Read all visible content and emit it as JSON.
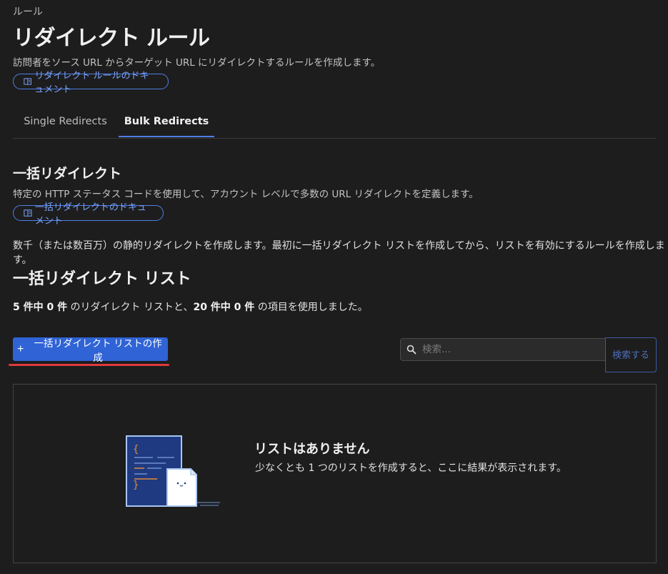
{
  "breadcrumb": "ルール",
  "page": {
    "title": "リダイレクト ルール",
    "subtitle": "訪問者をソース URL からターゲット URL にリダイレクトするルールを作成します。",
    "doc_link": "リダイレクト ルールのドキュメント"
  },
  "tabs": [
    {
      "label": "Single Redirects",
      "active": false
    },
    {
      "label": "Bulk Redirects",
      "active": true
    }
  ],
  "bulk": {
    "title": "一括リダイレクト",
    "description": "特定の HTTP ステータス コードを使用して、アカウント レベルで多数の URL リダイレクトを定義します。",
    "doc_link": "一括リダイレクトのドキュメント",
    "paragraph": "数千（または数百万）の静的リダイレクトを作成します。最初に一括リダイレクト リストを作成してから、リストを有効にするルールを作成します。"
  },
  "lists": {
    "title": "一括リダイレクト リスト",
    "usage_lists": "5 件中 0 件",
    "usage_mid": " のリダイレクト リストと、",
    "usage_items": "20 件中 0 件",
    "usage_end": " の項目を使用しました。",
    "create_icon": "+",
    "create_label": "一括リダイレクト リストの作成",
    "search_placeholder": "検索...",
    "search_button": "検索する"
  },
  "empty": {
    "title": "リストはありません",
    "description": "少なくとも 1 つのリストを作成すると、ここに結果が表示されます。"
  },
  "colors": {
    "accent": "#2f63d6",
    "link": "#7aa2ff",
    "highlight": "#e0393e",
    "background": "#1d1d1d"
  },
  "icons": {
    "doc": "book-icon",
    "search": "search-icon",
    "create": "plus-icon",
    "empty_state": "document-illustration"
  }
}
